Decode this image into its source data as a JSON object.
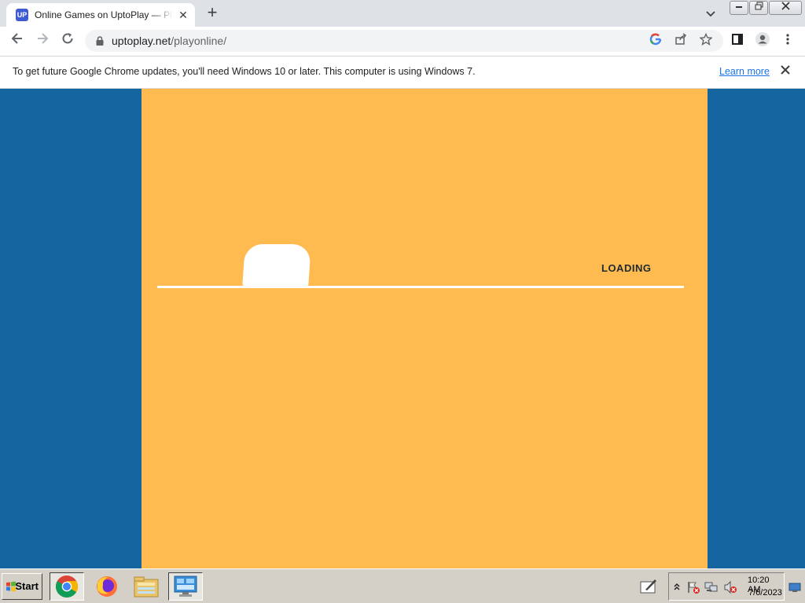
{
  "browser": {
    "tab": {
      "title": "Online Games on UptoPlay — Play & Share Free Games",
      "favicon": "uptoplay-icon"
    },
    "new_tab_label": "+",
    "window_controls": {
      "minimize": "—",
      "restore": "❐",
      "close": "✕"
    },
    "url": {
      "host": "uptoplay.net",
      "path": "/playonline/"
    },
    "omnibox_icons": [
      "google-lens-icon",
      "share-icon",
      "bookmark-star-icon"
    ],
    "toolbar_icons": [
      "back-icon",
      "forward-icon",
      "reload-icon",
      "side-panel-icon",
      "profile-icon",
      "menu-icon"
    ]
  },
  "infobar": {
    "message": "To get future Google Chrome updates, you'll need Windows 10 or later. This computer is using Windows 7.",
    "link": "Learn more"
  },
  "page": {
    "loading_text": "LOADING",
    "colors": {
      "side_background": "#1565a0",
      "game_background": "#ffbb50",
      "loader": "#ffffff"
    }
  },
  "taskbar": {
    "start_label": "Start",
    "apps": [
      "chrome-icon",
      "firefox-icon",
      "file-explorer-icon",
      "control-panel-icon"
    ],
    "tray_icons": [
      "show-hidden-icons",
      "action-center-flag-icon",
      "network-icon",
      "volume-muted-icon"
    ],
    "clock": {
      "time": "10:20 AM",
      "date": "7/6/2023"
    }
  }
}
